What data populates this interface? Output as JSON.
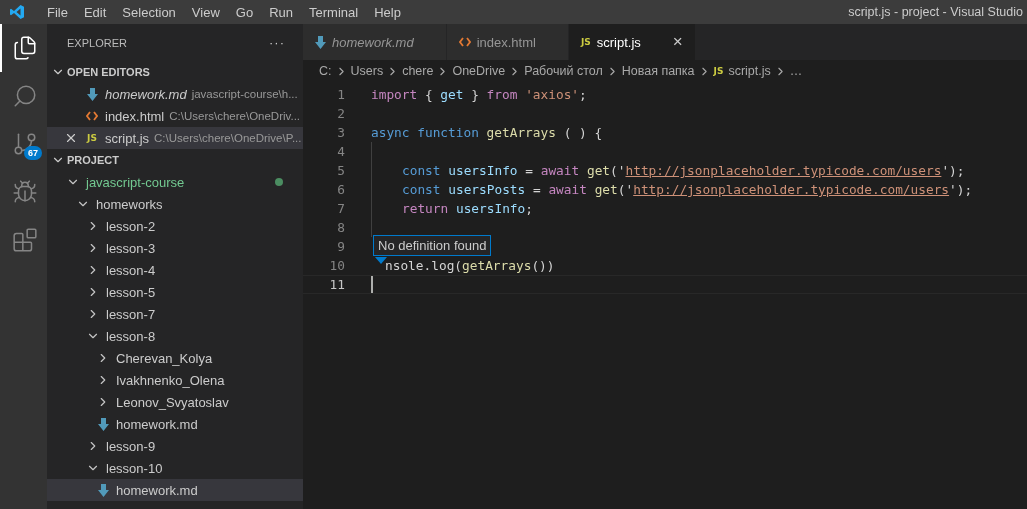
{
  "window": {
    "title": "script.js - project - Visual Studio"
  },
  "menu": [
    "File",
    "Edit",
    "Selection",
    "View",
    "Go",
    "Run",
    "Terminal",
    "Help"
  ],
  "activity_bar": [
    {
      "kind": "explorer",
      "selected": true
    },
    {
      "kind": "search",
      "selected": false
    },
    {
      "kind": "source-control",
      "selected": false,
      "badge": "67"
    },
    {
      "kind": "debug",
      "selected": false
    },
    {
      "kind": "extensions",
      "selected": false
    }
  ],
  "sidebar": {
    "title": "EXPLORER",
    "more": "···",
    "open_editors": {
      "title": "OPEN EDITORS",
      "expanded": true,
      "items": [
        {
          "name": "homework.md",
          "path": "javascript-course\\h...",
          "kind": "md",
          "preview": true,
          "selected": false
        },
        {
          "name": "index.html",
          "path": "C:\\Users\\chere\\OneDriv...",
          "kind": "html",
          "preview": false,
          "selected": false
        },
        {
          "name": "script.js",
          "path": "C:\\Users\\chere\\OneDrive\\P...",
          "kind": "js",
          "icon_text": "JS",
          "preview": false,
          "selected": true
        }
      ]
    },
    "project": {
      "title": "PROJECT",
      "expanded": true,
      "tree": [
        {
          "name": "javascript-course",
          "kind": "folder",
          "expanded": true,
          "modified": true,
          "selected": false,
          "children": [
            {
              "name": "homeworks",
              "kind": "folder",
              "expanded": true,
              "modified": false,
              "selected": false,
              "children": [
                {
                  "name": "lesson-2",
                  "kind": "folder",
                  "expanded": false,
                  "modified": false,
                  "selected": false
                },
                {
                  "name": "lesson-3",
                  "kind": "folder",
                  "expanded": false,
                  "modified": false,
                  "selected": false
                },
                {
                  "name": "lesson-4",
                  "kind": "folder",
                  "expanded": false,
                  "modified": false,
                  "selected": false
                },
                {
                  "name": "lesson-5",
                  "kind": "folder",
                  "expanded": false,
                  "modified": false,
                  "selected": false
                },
                {
                  "name": "lesson-7",
                  "kind": "folder",
                  "expanded": false,
                  "modified": false,
                  "selected": false
                },
                {
                  "name": "lesson-8",
                  "kind": "folder",
                  "expanded": true,
                  "modified": false,
                  "selected": false,
                  "children": [
                    {
                      "name": "Cherevan_Kolya",
                      "kind": "folder",
                      "expanded": false,
                      "modified": false,
                      "selected": false
                    },
                    {
                      "name": "Ivakhnenko_Olena",
                      "kind": "folder",
                      "expanded": false,
                      "modified": false,
                      "selected": false
                    },
                    {
                      "name": "Leonov_Svyatoslav",
                      "kind": "folder",
                      "expanded": false,
                      "modified": false,
                      "selected": false
                    },
                    {
                      "name": "homework.md",
                      "kind": "file",
                      "modified": false,
                      "selected": false
                    }
                  ]
                },
                {
                  "name": "lesson-9",
                  "kind": "folder",
                  "expanded": false,
                  "modified": false,
                  "selected": false
                },
                {
                  "name": "lesson-10",
                  "kind": "folder",
                  "expanded": true,
                  "modified": false,
                  "selected": false,
                  "children": [
                    {
                      "name": "homework.md",
                      "kind": "file",
                      "modified": false,
                      "selected": true
                    }
                  ]
                }
              ]
            }
          ]
        }
      ]
    }
  },
  "tabs": [
    {
      "name": "homework.md",
      "kind": "md",
      "preview": true,
      "selected": false
    },
    {
      "name": "index.html",
      "kind": "html",
      "preview": false,
      "selected": false
    },
    {
      "name": "script.js",
      "kind": "js",
      "icon_text": "JS",
      "preview": false,
      "selected": true,
      "close": "×"
    }
  ],
  "breadcrumb": [
    {
      "text": "C:"
    },
    {
      "text": "Users"
    },
    {
      "text": "chere"
    },
    {
      "text": "OneDrive"
    },
    {
      "text": "Рабочий стол"
    },
    {
      "text": "Новая папка"
    },
    {
      "text": "script.js",
      "kind": "js",
      "icon_text": "JS"
    },
    {
      "text": "…"
    }
  ],
  "editor": {
    "lines": [
      {
        "number": "1",
        "indented": false,
        "cursor": false,
        "tokens": [
          {
            "text": "import",
            "kind": "control"
          },
          {
            "text": " { ",
            "kind": "plain"
          },
          {
            "text": "get",
            "kind": "var"
          },
          {
            "text": " } ",
            "kind": "plain"
          },
          {
            "text": "from",
            "kind": "control"
          },
          {
            "text": " 'axios'",
            "kind": "string"
          },
          {
            "text": ";",
            "kind": "plain"
          }
        ]
      },
      {
        "number": "2",
        "indented": false,
        "cursor": false
      },
      {
        "number": "3",
        "indented": false,
        "cursor": false,
        "tokens": [
          {
            "text": "async function",
            "kind": "storage"
          },
          {
            "text": " getArrays",
            "kind": "func"
          },
          {
            "text": " ( ) {",
            "kind": "plain"
          }
        ]
      },
      {
        "number": "4",
        "indented": true,
        "cursor": false
      },
      {
        "number": "5",
        "indented": true,
        "cursor": false,
        "tokens": [
          {
            "text": "const",
            "kind": "storage"
          },
          {
            "text": " usersInfo",
            "kind": "var"
          },
          {
            "text": " = ",
            "kind": "plain"
          },
          {
            "text": "await",
            "kind": "control"
          },
          {
            "text": " get",
            "kind": "func"
          },
          {
            "text": "('",
            "kind": "plain"
          },
          {
            "text": "http://jsonplaceholder.typicode.com/users",
            "kind": "link"
          },
          {
            "text": "');",
            "kind": "plain"
          }
        ]
      },
      {
        "number": "6",
        "indented": true,
        "cursor": false,
        "tokens": [
          {
            "text": "const",
            "kind": "storage"
          },
          {
            "text": " usersPosts",
            "kind": "var"
          },
          {
            "text": " = ",
            "kind": "plain"
          },
          {
            "text": "await",
            "kind": "control"
          },
          {
            "text": " get",
            "kind": "func"
          },
          {
            "text": "('",
            "kind": "plain"
          },
          {
            "text": "http://jsonplaceholder.typicode.com/users",
            "kind": "link"
          },
          {
            "text": "');",
            "kind": "plain"
          }
        ]
      },
      {
        "number": "7",
        "indented": true,
        "cursor": false,
        "tokens": [
          {
            "text": "return",
            "kind": "control"
          },
          {
            "text": " usersInfo",
            "kind": "var"
          },
          {
            "text": ";",
            "kind": "plain"
          }
        ]
      },
      {
        "number": "8",
        "indented": true,
        "cursor": false
      },
      {
        "number": "9",
        "indented": false,
        "cursor": false
      },
      {
        "number": "10",
        "indented": false,
        "cursor": false,
        "tokens": [
          {
            "text": "nsole.log(",
            "kind": "plain"
          },
          {
            "text": "getArrays",
            "kind": "func"
          },
          {
            "text": "())",
            "kind": "plain"
          }
        ],
        "tooltip": "No definition found"
      },
      {
        "number": "11",
        "indented": false,
        "cursor": true
      }
    ]
  }
}
